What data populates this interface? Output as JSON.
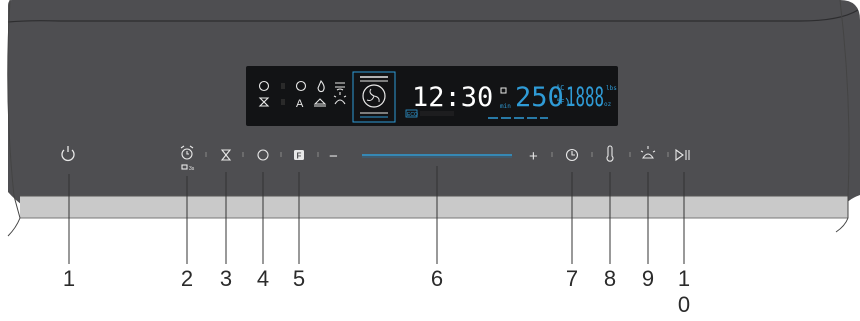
{
  "display": {
    "time": "12:30",
    "time_unit": "min",
    "temperature": "250",
    "unit_c": "°C",
    "unit_f": "°F",
    "weight": "1888",
    "weight_units": [
      "lbs",
      "oz"
    ],
    "eco_badge": "ECO",
    "icons": [
      "alarm-icon",
      "hourglass-icon",
      "rotisserie-icon",
      "steam-drop-icon",
      "grill-icon",
      "auto-A-icon",
      "defrost-icon",
      "oven-light-icon",
      "fan-icon"
    ],
    "accent_color": "#2f9bd6",
    "text_color": "#ffffff"
  },
  "controls": [
    {
      "id": "1",
      "name": "power-button",
      "icon": "power-icon"
    },
    {
      "id": "2",
      "name": "alarm-lock-button",
      "icon": "alarm-clock-icon",
      "sublabel": "3s"
    },
    {
      "id": "3",
      "name": "timer-button",
      "icon": "hourglass-icon"
    },
    {
      "id": "4",
      "name": "quick-preheat-button",
      "icon": "rotisserie-icon"
    },
    {
      "id": "5",
      "name": "function-button",
      "icon": "F-icon",
      "glyph": "F"
    },
    {
      "id": "6",
      "name": "slider-control",
      "icon": "slider-icon",
      "minus": "−",
      "plus": "+"
    },
    {
      "id": "7",
      "name": "clock-button",
      "icon": "clock-icon"
    },
    {
      "id": "8",
      "name": "temperature-button",
      "icon": "thermometer-icon"
    },
    {
      "id": "9",
      "name": "light-button",
      "icon": "lamp-icon"
    },
    {
      "id": "10",
      "name": "start-pause-button",
      "icon": "play-pause-icon"
    }
  ],
  "callouts": [
    "1",
    "2",
    "3",
    "4",
    "5",
    "6",
    "7",
    "8",
    "9",
    "1",
    "0"
  ],
  "colors": {
    "panel": "#4f4f52",
    "panel_edge": "#3a3a3c",
    "rail": "#c7c7c7",
    "lcd_bg": "#121315",
    "icon": "#e8e8e8"
  }
}
